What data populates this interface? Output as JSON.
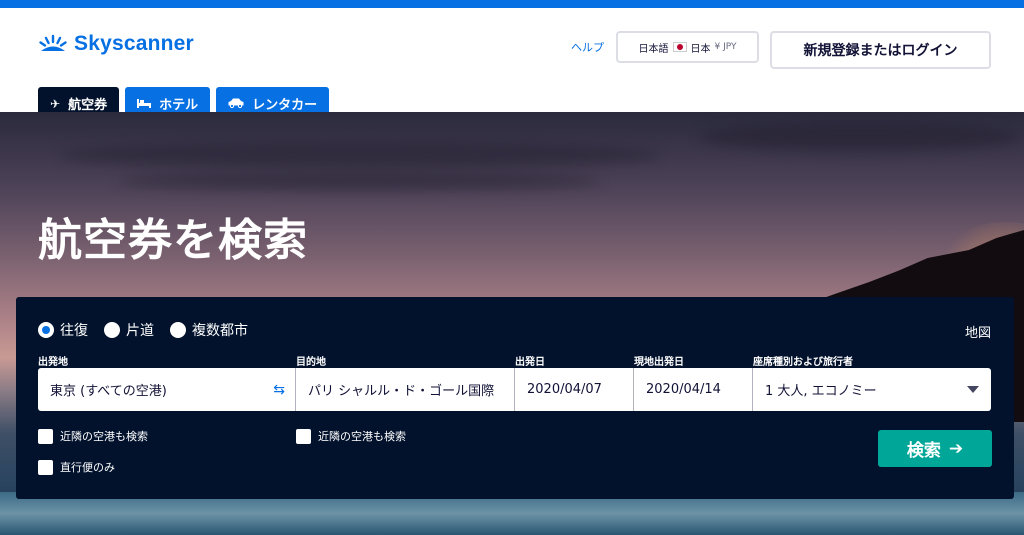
{
  "brand": {
    "name": "Skyscanner",
    "color": "#0770e3"
  },
  "header": {
    "help_label": "ヘルプ",
    "locale": {
      "language": "日本語",
      "country": "日本",
      "currency": "¥ JPY"
    },
    "login_label": "新規登録またはログイン"
  },
  "tabs": [
    {
      "label": "航空券",
      "icon": "plane-icon",
      "active": true
    },
    {
      "label": "ホテル",
      "icon": "bed-icon",
      "active": false
    },
    {
      "label": "レンタカー",
      "icon": "car-icon",
      "active": false
    }
  ],
  "hero": {
    "title": "航空券を検索"
  },
  "search": {
    "trip_types": [
      {
        "label": "往復",
        "checked": true
      },
      {
        "label": "片道",
        "checked": false
      },
      {
        "label": "複数都市",
        "checked": false
      }
    ],
    "map_label": "地図",
    "labels": {
      "from": "出発地",
      "to": "目的地",
      "depart": "出発日",
      "return": "現地出発日",
      "pax": "座席種別および旅行者"
    },
    "values": {
      "from": "東京 (すべての空港)",
      "to": "パリ シャルル・ド・ゴール国際",
      "depart": "2020/04/07",
      "return": "2020/04/14",
      "pax": "1 大人, エコノミー"
    },
    "checkboxes": {
      "nearby_from": "近隣の空港も検索",
      "nearby_to": "近隣の空港も検索",
      "direct_only": "直行便のみ"
    },
    "submit_label": "検索",
    "submit_color": "#00a698"
  }
}
